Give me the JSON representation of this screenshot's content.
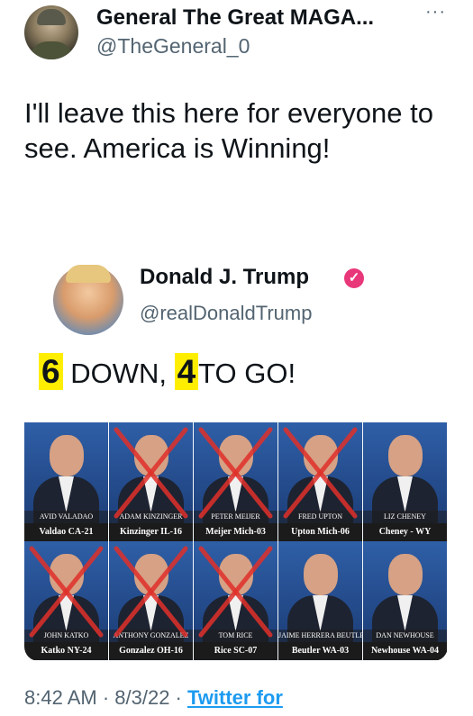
{
  "tweet": {
    "author_name": "General The Great MAGA...",
    "author_handle": "@TheGeneral_0",
    "more_icon": "more-horizontal-icon",
    "text": "I'll leave this here for everyone to see. America is Winning!",
    "timestamp": "8:42 AM · 8/3/22 · ",
    "source_link": "Twitter for"
  },
  "embedded": {
    "name": "Donald J. Trump",
    "handle": "@realDonaldTrump",
    "verified_icon": "verified-badge-icon",
    "headline": {
      "num1": "6",
      "text1": " DOWN, ",
      "num2": "4",
      "text2": "TO GO!"
    },
    "highlight_color": "#ffee00",
    "cross_color": "#e0302a",
    "members": [
      {
        "nameplate": "AVID VALADAO",
        "caption": "Valdao CA-21",
        "crossed": false
      },
      {
        "nameplate": "ADAM KINZINGER",
        "caption": "Kinzinger IL-16",
        "crossed": true
      },
      {
        "nameplate": "PETER MEIJER",
        "caption": "Meijer Mich-03",
        "crossed": true
      },
      {
        "nameplate": "FRED UPTON",
        "caption": "Upton Mich-06",
        "crossed": true
      },
      {
        "nameplate": "LIZ CHENEY",
        "caption": "Cheney - WY",
        "crossed": false
      },
      {
        "nameplate": "JOHN KATKO",
        "caption": "Katko NY-24",
        "crossed": true
      },
      {
        "nameplate": "ANTHONY GONZALEZ",
        "caption": "Gonzalez OH-16",
        "crossed": true
      },
      {
        "nameplate": "TOM RICE",
        "caption": "Rice SC-07",
        "crossed": true
      },
      {
        "nameplate": "JAIME HERRERA BEUTLER",
        "caption": "Beutler WA-03",
        "crossed": false
      },
      {
        "nameplate": "DAN NEWHOUSE",
        "caption": "Newhouse WA-04",
        "crossed": false
      }
    ]
  }
}
